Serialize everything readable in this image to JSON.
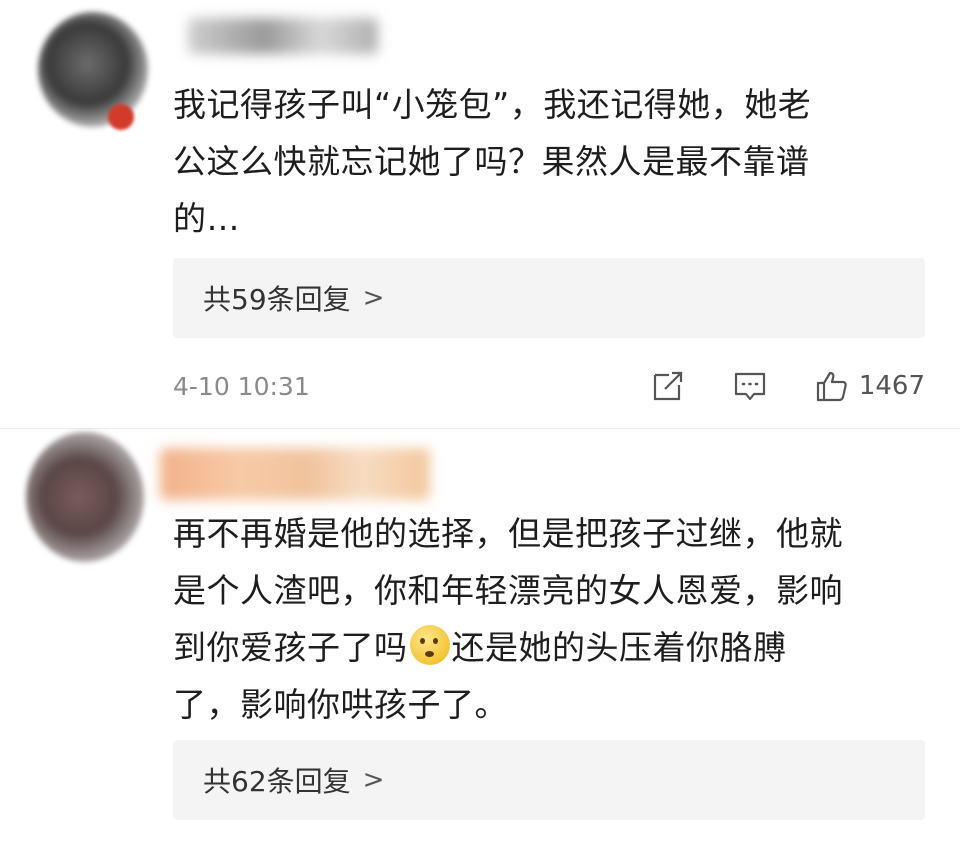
{
  "comments": [
    {
      "text": "我记得孩子叫“小笼包”，我还记得她，她老\n公这么快就忘记她了吗？果然人是最不靠谱\n的…",
      "replies_label": "共59条回复",
      "replies_chevron": ">",
      "timestamp": "4-10 10:31",
      "like_count": "1467"
    },
    {
      "text_part1": "再不再婚是他的选择，但是把孩子过继，他就\n是个人渣吧，你和年轻漂亮的女人恩爱，影响\n到你爱孩子了吗",
      "emoji": "thinking-face-emoji",
      "text_part2": "还是她的头压着你胳膊\n了，影响你哄孩子了。",
      "replies_label": "共62条回复",
      "replies_chevron": ">"
    }
  ],
  "icons": {
    "share": "share-icon",
    "comment": "comment-icon",
    "like": "thumbs-up-icon"
  },
  "colors": {
    "reply_box_bg": "#f4f4f4",
    "meta_text": "#8a8a8a",
    "body_text": "#1e1e1e"
  }
}
